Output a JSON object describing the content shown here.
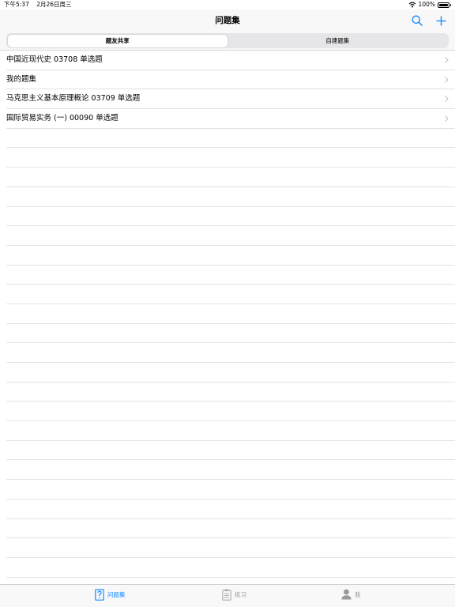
{
  "statusbar": {
    "time": "下午5:37",
    "date": "2月26日周三",
    "battery": "100%"
  },
  "navbar": {
    "title": "问题集",
    "search_icon": "search-icon",
    "add_icon": "plus-icon"
  },
  "colors": {
    "accent": "#1a8cff",
    "inactive": "#999999"
  },
  "segments": [
    {
      "label": "题友共享",
      "selected": true
    },
    {
      "label": "自建题集",
      "selected": false
    }
  ],
  "list": [
    {
      "label": "中国近现代史 03708 单选题"
    },
    {
      "label": "我的题集"
    },
    {
      "label": "马克思主义基本原理概论 03709 单选题"
    },
    {
      "label": "国际贸易实务 (一) 00090 单选题"
    }
  ],
  "tabs": [
    {
      "label": "问题集",
      "icon": "question-book-icon",
      "active": true
    },
    {
      "label": "练习",
      "icon": "clipboard-icon",
      "active": false
    },
    {
      "label": "我",
      "icon": "person-icon",
      "active": false
    }
  ]
}
